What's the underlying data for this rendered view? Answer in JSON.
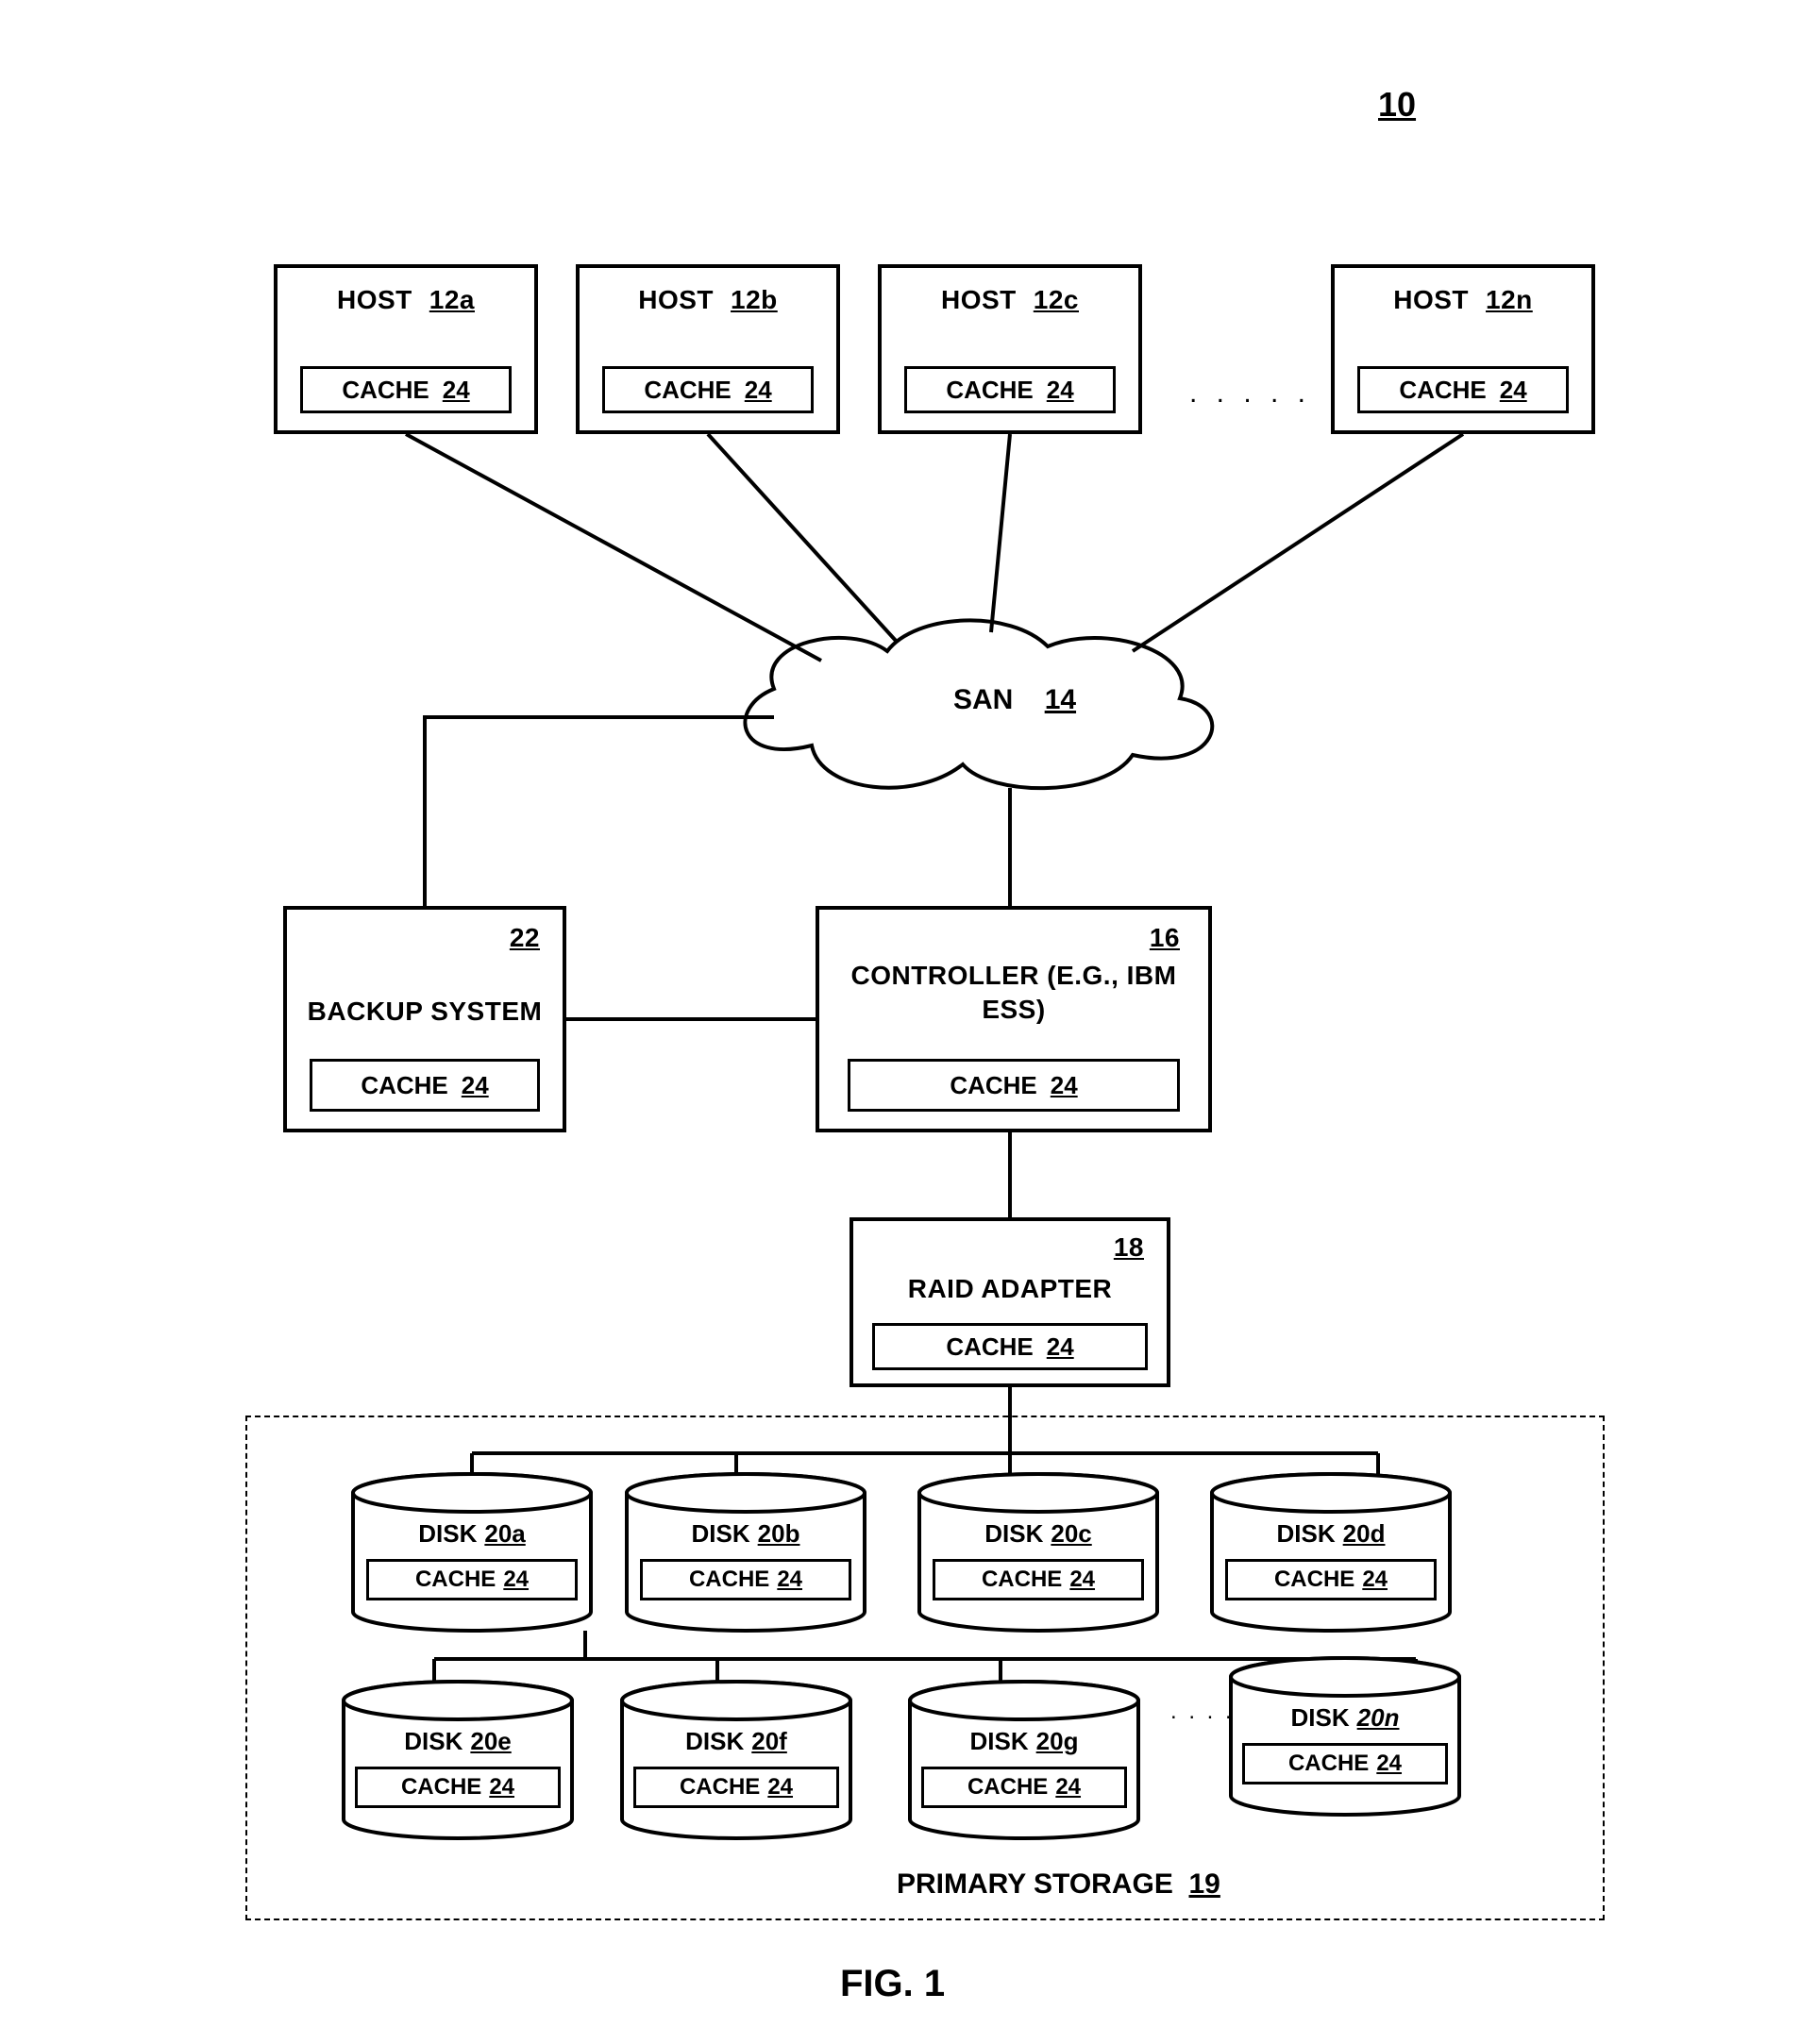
{
  "figure_ref": "10",
  "figure_label": "FIG. 1",
  "hosts": {
    "a": {
      "label": "HOST",
      "id": "12a"
    },
    "b": {
      "label": "HOST",
      "id": "12b"
    },
    "c": {
      "label": "HOST",
      "id": "12c"
    },
    "n": {
      "label": "HOST",
      "id": "12n"
    }
  },
  "host_ellipsis": ". . . . .",
  "cache": {
    "label": "CACHE",
    "id": "24"
  },
  "cloud": {
    "label": "SAN",
    "id": "14"
  },
  "backup": {
    "label": "BACKUP SYSTEM",
    "id": "22"
  },
  "controller": {
    "id": "16",
    "line1": "CONTROLLER (E.G., IBM",
    "line2": "ESS)"
  },
  "raid": {
    "id": "18",
    "label": "RAID ADAPTER"
  },
  "disks": {
    "a": {
      "label": "DISK",
      "id": "20a"
    },
    "b": {
      "label": "DISK",
      "id": "20b"
    },
    "c": {
      "label": "DISK",
      "id": "20c"
    },
    "d": {
      "label": "DISK",
      "id": "20d"
    },
    "e": {
      "label": "DISK",
      "id": "20e"
    },
    "f": {
      "label": "DISK",
      "id": "20f"
    },
    "g": {
      "label": "DISK",
      "id": "20g"
    },
    "n": {
      "label": "DISK",
      "id": "20n"
    }
  },
  "disk_ellipsis": ". . . . .",
  "primary_storage": {
    "label": "PRIMARY STORAGE",
    "id": "19"
  }
}
